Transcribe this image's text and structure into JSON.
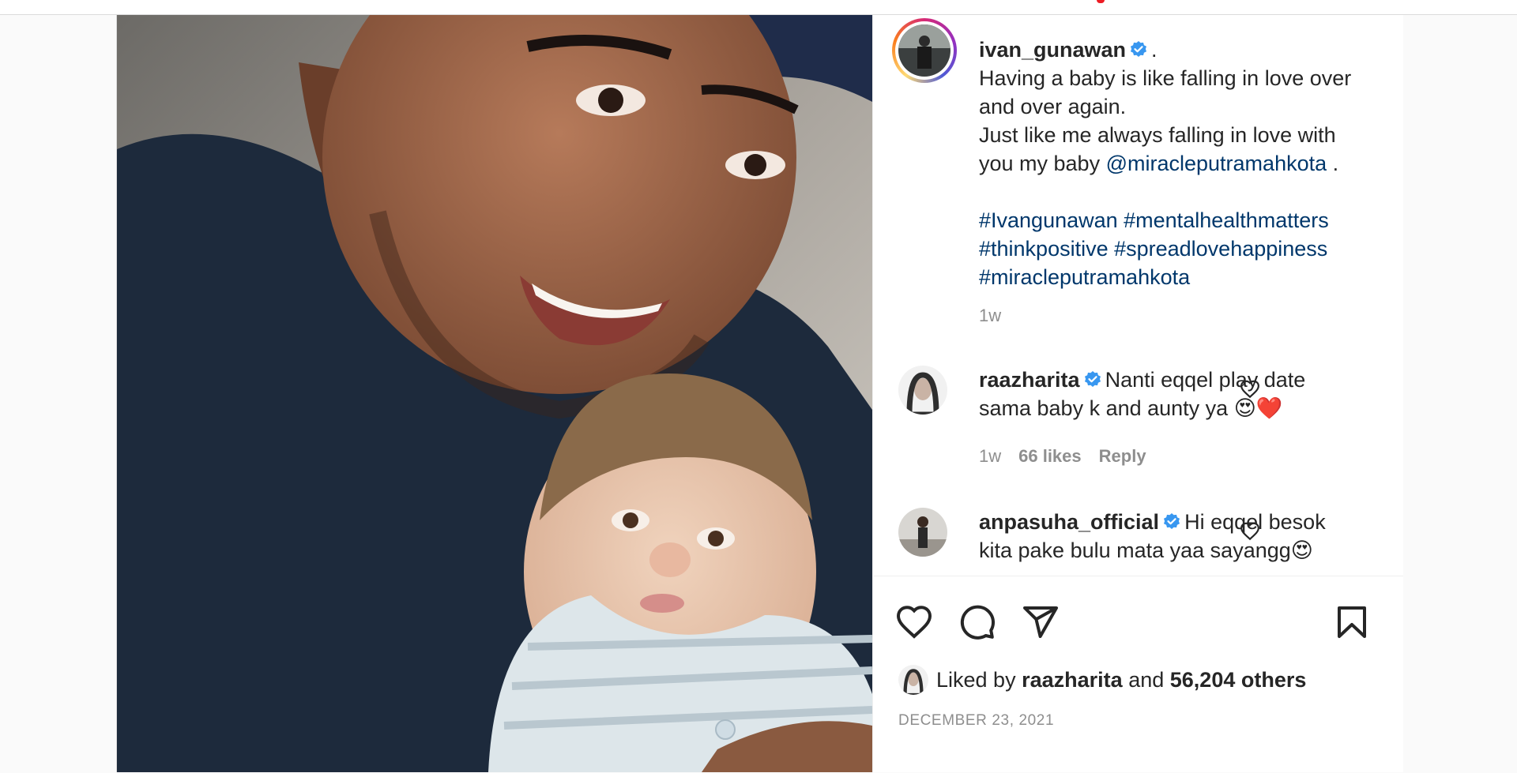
{
  "post": {
    "author": "ivan_gunawan",
    "author_suffix": ".",
    "caption_lines": [
      "Having a baby is like falling in love over",
      "and over again.",
      "Just like me always falling in love with",
      "you my baby"
    ],
    "mention": "@miracleputramahkota",
    "mention_suffix": ".",
    "hashtags_line1": "#Ivangunawan #mentalhealthmatters",
    "hashtags_line2": "#thinkpositive #spreadlovehappiness",
    "hashtags_line3": "#miracleputramahkota",
    "time": "1w"
  },
  "comments": [
    {
      "user": "raazharita",
      "text_line1": "Nanti eqqel play date",
      "text_line2": "sama baby k and aunty ya 😍❤️",
      "time": "1w",
      "likes": "66 likes",
      "reply": "Reply"
    },
    {
      "user": "anpasuha_official",
      "text_line1": "Hi eqqel besok",
      "text_line2": "kita pake bulu mata yaa sayangg😍"
    }
  ],
  "likes": {
    "prefix": "Liked by",
    "user": "raazharita",
    "connector": "and",
    "others": "56,204 others"
  },
  "date": "DECEMBER 23, 2021",
  "icons": [
    "verified-badge-icon",
    "heart-icon",
    "comment-icon",
    "share-icon",
    "bookmark-icon"
  ],
  "colors": {
    "link": "#00376b",
    "verified": "#3897f0",
    "muted": "#8e8e8e",
    "text": "#262626"
  }
}
